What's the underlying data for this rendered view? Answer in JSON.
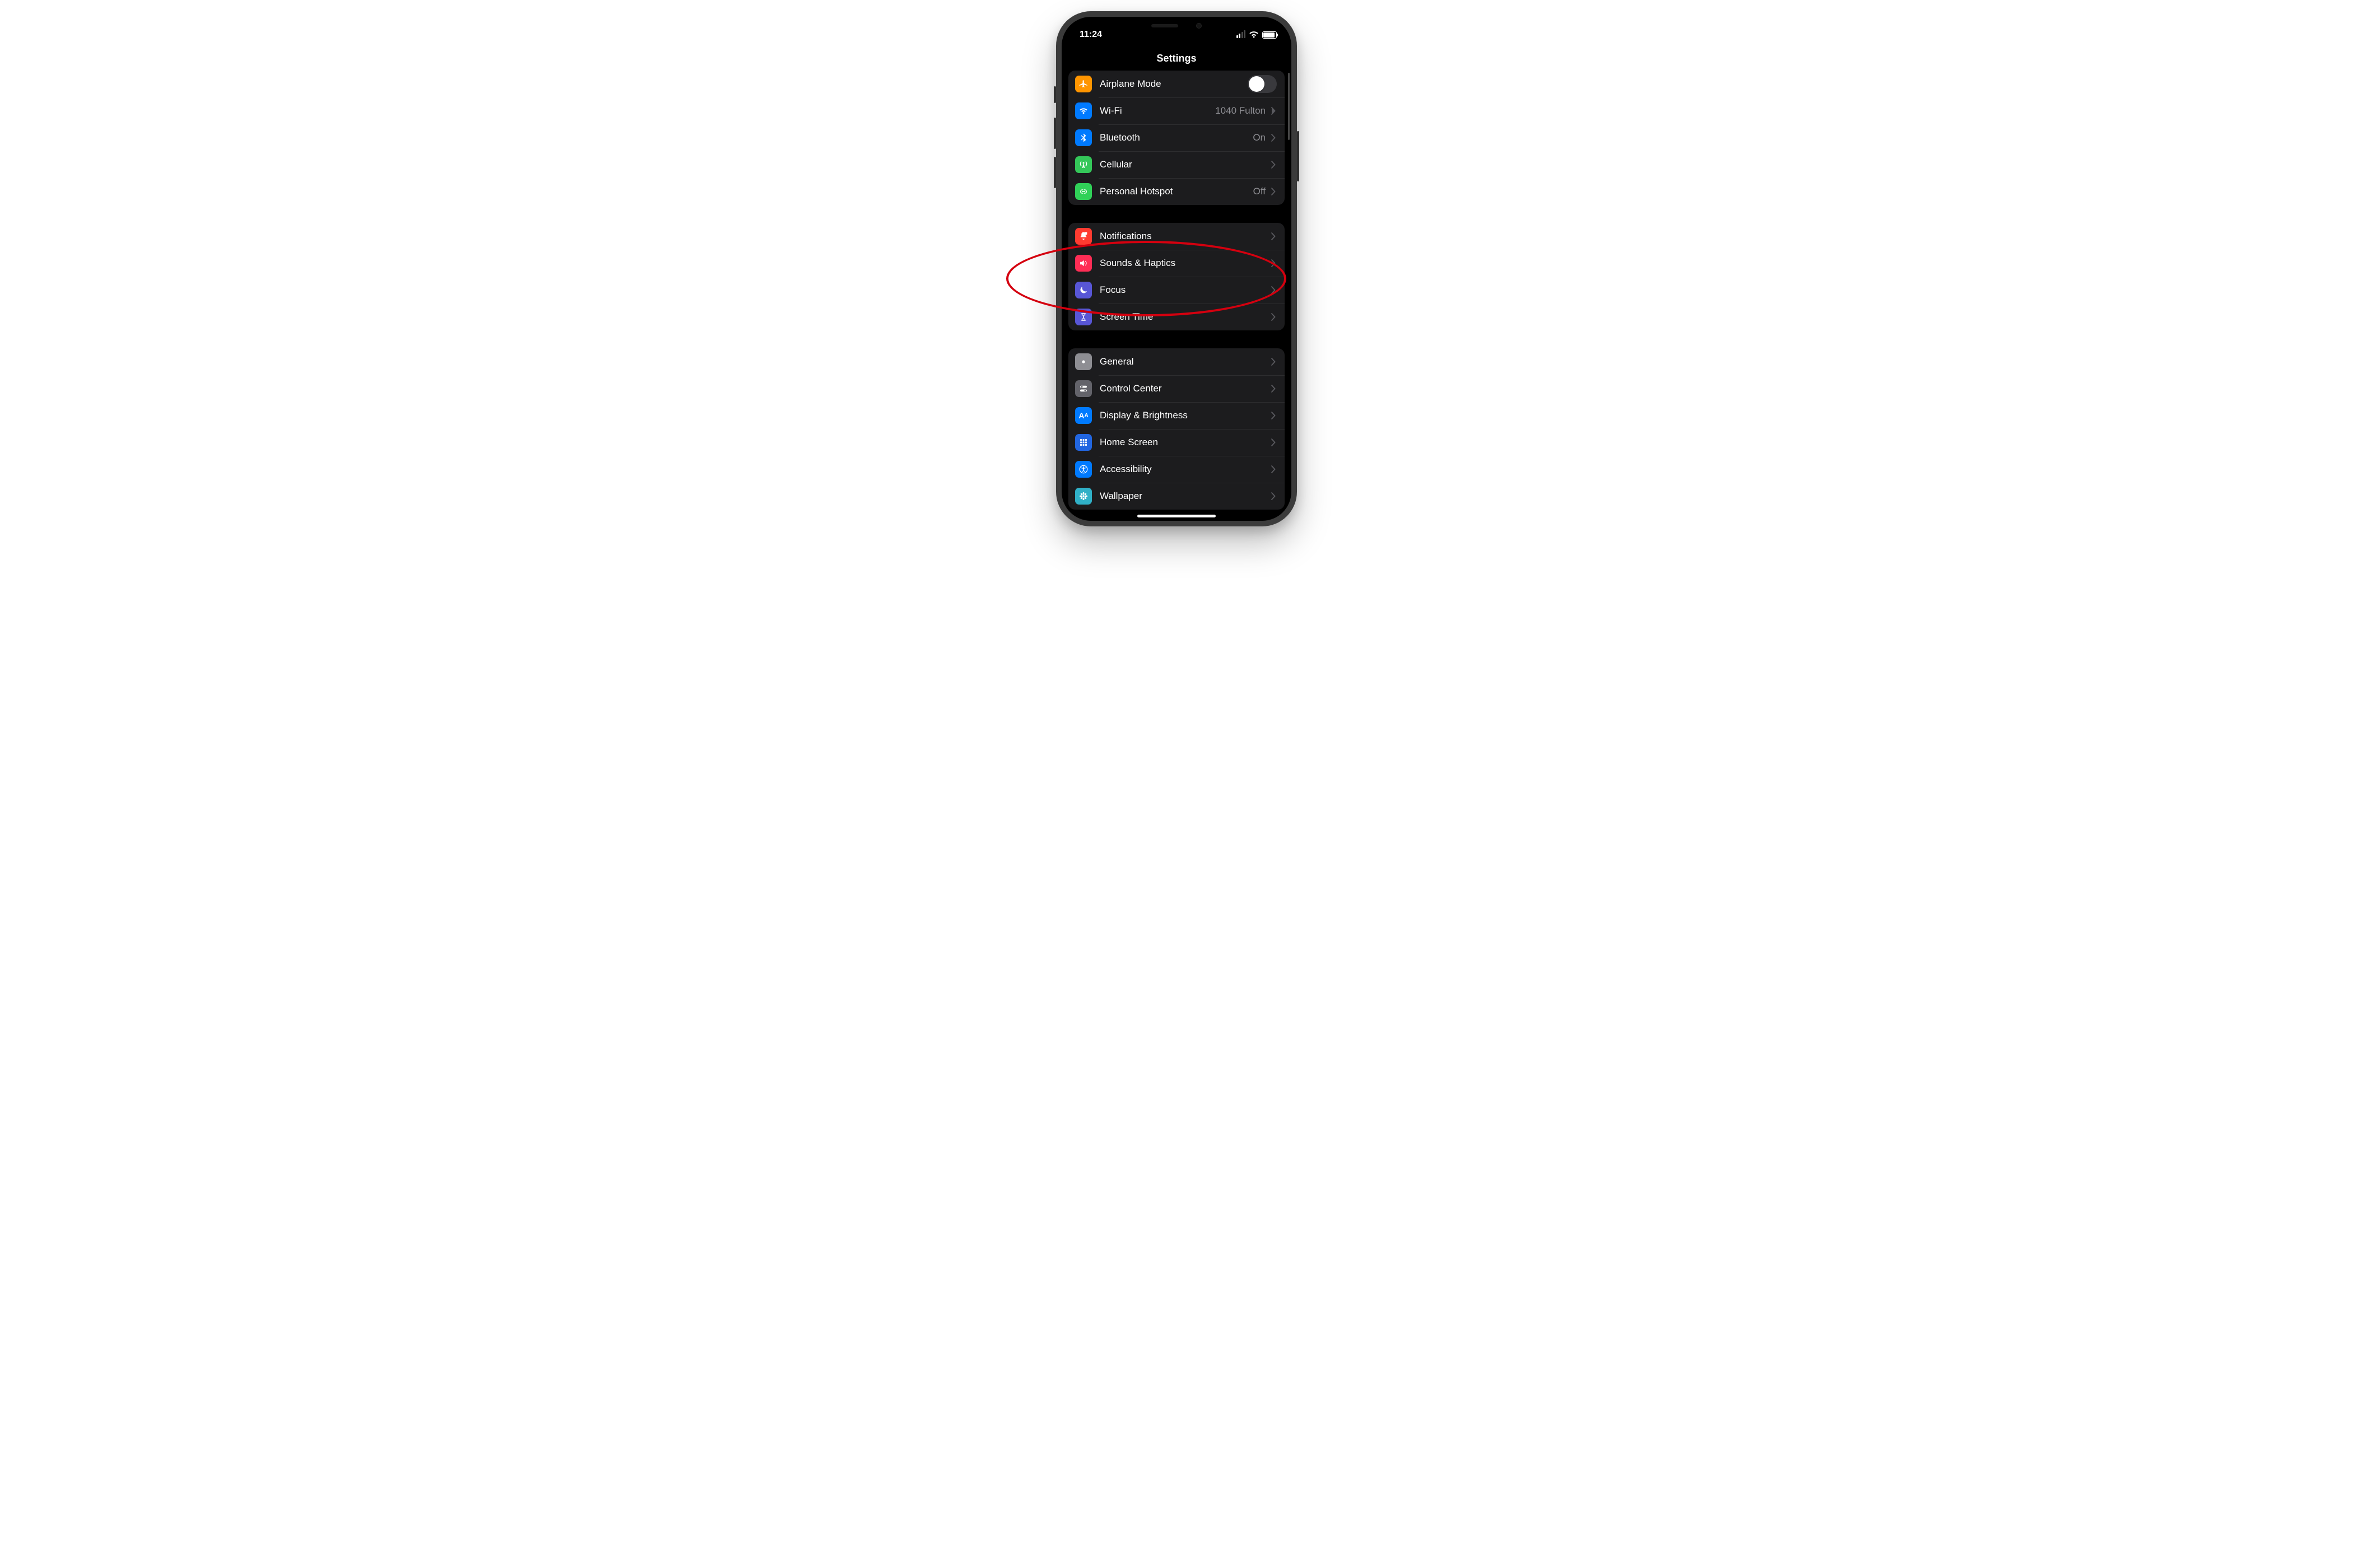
{
  "status": {
    "time": "11:24"
  },
  "title": "Settings",
  "groups": [
    {
      "id": "connectivity",
      "rows": [
        {
          "id": "airplane",
          "label": "Airplane Mode",
          "value": "",
          "kind": "toggle",
          "icon": "airplane",
          "color": "c-orange"
        },
        {
          "id": "wifi",
          "label": "Wi-Fi",
          "value": "1040 Fulton",
          "kind": "link",
          "icon": "wifi",
          "color": "c-blue"
        },
        {
          "id": "bluetooth",
          "label": "Bluetooth",
          "value": "On",
          "kind": "link",
          "icon": "bluetooth",
          "color": "c-blue"
        },
        {
          "id": "cellular",
          "label": "Cellular",
          "value": "",
          "kind": "link",
          "icon": "antenna",
          "color": "c-green"
        },
        {
          "id": "hotspot",
          "label": "Personal Hotspot",
          "value": "Off",
          "kind": "link",
          "icon": "hotspot",
          "color": "c-green2"
        }
      ]
    },
    {
      "id": "attention",
      "rows": [
        {
          "id": "notifications",
          "label": "Notifications",
          "value": "",
          "kind": "link",
          "icon": "bell",
          "color": "c-red"
        },
        {
          "id": "sounds",
          "label": "Sounds & Haptics",
          "value": "",
          "kind": "link",
          "icon": "speaker",
          "color": "c-pink"
        },
        {
          "id": "focus",
          "label": "Focus",
          "value": "",
          "kind": "link",
          "icon": "moon",
          "color": "c-indigo"
        },
        {
          "id": "screentime",
          "label": "Screen Time",
          "value": "",
          "kind": "link",
          "icon": "hourglass",
          "color": "c-indigo"
        }
      ]
    },
    {
      "id": "system",
      "rows": [
        {
          "id": "general",
          "label": "General",
          "value": "",
          "kind": "link",
          "icon": "gear",
          "color": "c-gray"
        },
        {
          "id": "control",
          "label": "Control Center",
          "value": "",
          "kind": "link",
          "icon": "switches",
          "color": "c-gray-d"
        },
        {
          "id": "display",
          "label": "Display & Brightness",
          "value": "",
          "kind": "link",
          "icon": "aa",
          "color": "c-blue"
        },
        {
          "id": "home",
          "label": "Home Screen",
          "value": "",
          "kind": "link",
          "icon": "grid",
          "color": "c-dblue"
        },
        {
          "id": "access",
          "label": "Accessibility",
          "value": "",
          "kind": "link",
          "icon": "person",
          "color": "c-blue"
        },
        {
          "id": "wallpaper",
          "label": "Wallpaper",
          "value": "",
          "kind": "link",
          "icon": "flower",
          "color": "c-teal"
        }
      ]
    }
  ],
  "annotation": {
    "present": true,
    "targets": [
      "notifications",
      "sounds",
      "focus"
    ]
  }
}
